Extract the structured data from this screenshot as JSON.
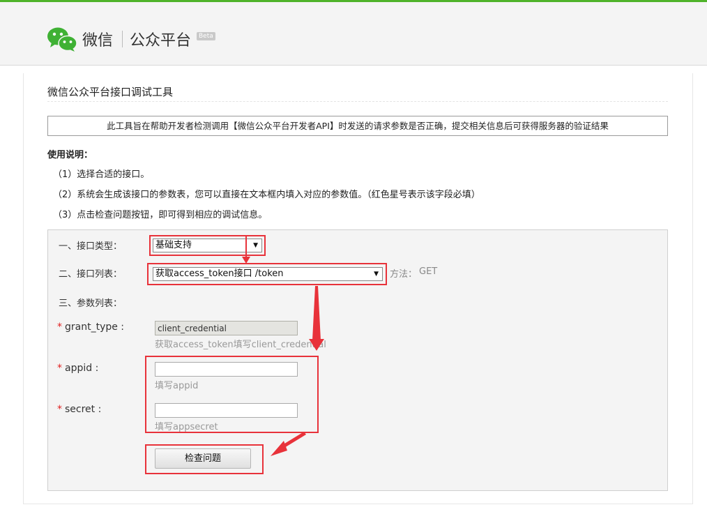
{
  "header": {
    "brand_wechat": "微信",
    "brand_platform": "公众平台",
    "beta": "Beta"
  },
  "page": {
    "title": "微信公众平台接口调试工具",
    "notice": "此工具旨在帮助开发者检测调用【微信公众平台开发者API】时发送的请求参数是否正确，提交相关信息后可获得服务器的验证结果"
  },
  "usage": {
    "title": "使用说明：",
    "steps": [
      "（1）选择合适的接口。",
      "（2）系统会生成该接口的参数表，您可以直接在文本框内填入对应的参数值。（红色星号表示该字段必填）",
      "（3）点击检查问题按钮，即可得到相应的调试信息。"
    ]
  },
  "form": {
    "type_label": "一、接口类型：",
    "type_value": "基础支持",
    "list_label": "二、接口列表：",
    "list_value": "获取access_token接口 /token",
    "method_label": "方法：",
    "method_value": "GET",
    "params_label": "三、参数列表：",
    "required_mark": "*",
    "params": [
      {
        "name": "grant_type :",
        "value": "client_credential",
        "hint": "获取access_token填写client_credential"
      },
      {
        "name": "appid :",
        "value": "",
        "hint": "填写appid"
      },
      {
        "name": "secret :",
        "value": "",
        "hint": "填写appsecret"
      }
    ],
    "submit_label": "检查问题"
  },
  "colors": {
    "brand_green": "#4fb32a",
    "annotation_red": "#e8323a",
    "required_red": "#e02020"
  },
  "icons": [
    "wechat-logo-icon",
    "dropdown-arrow-icon",
    "annotation-arrow-icon"
  ]
}
